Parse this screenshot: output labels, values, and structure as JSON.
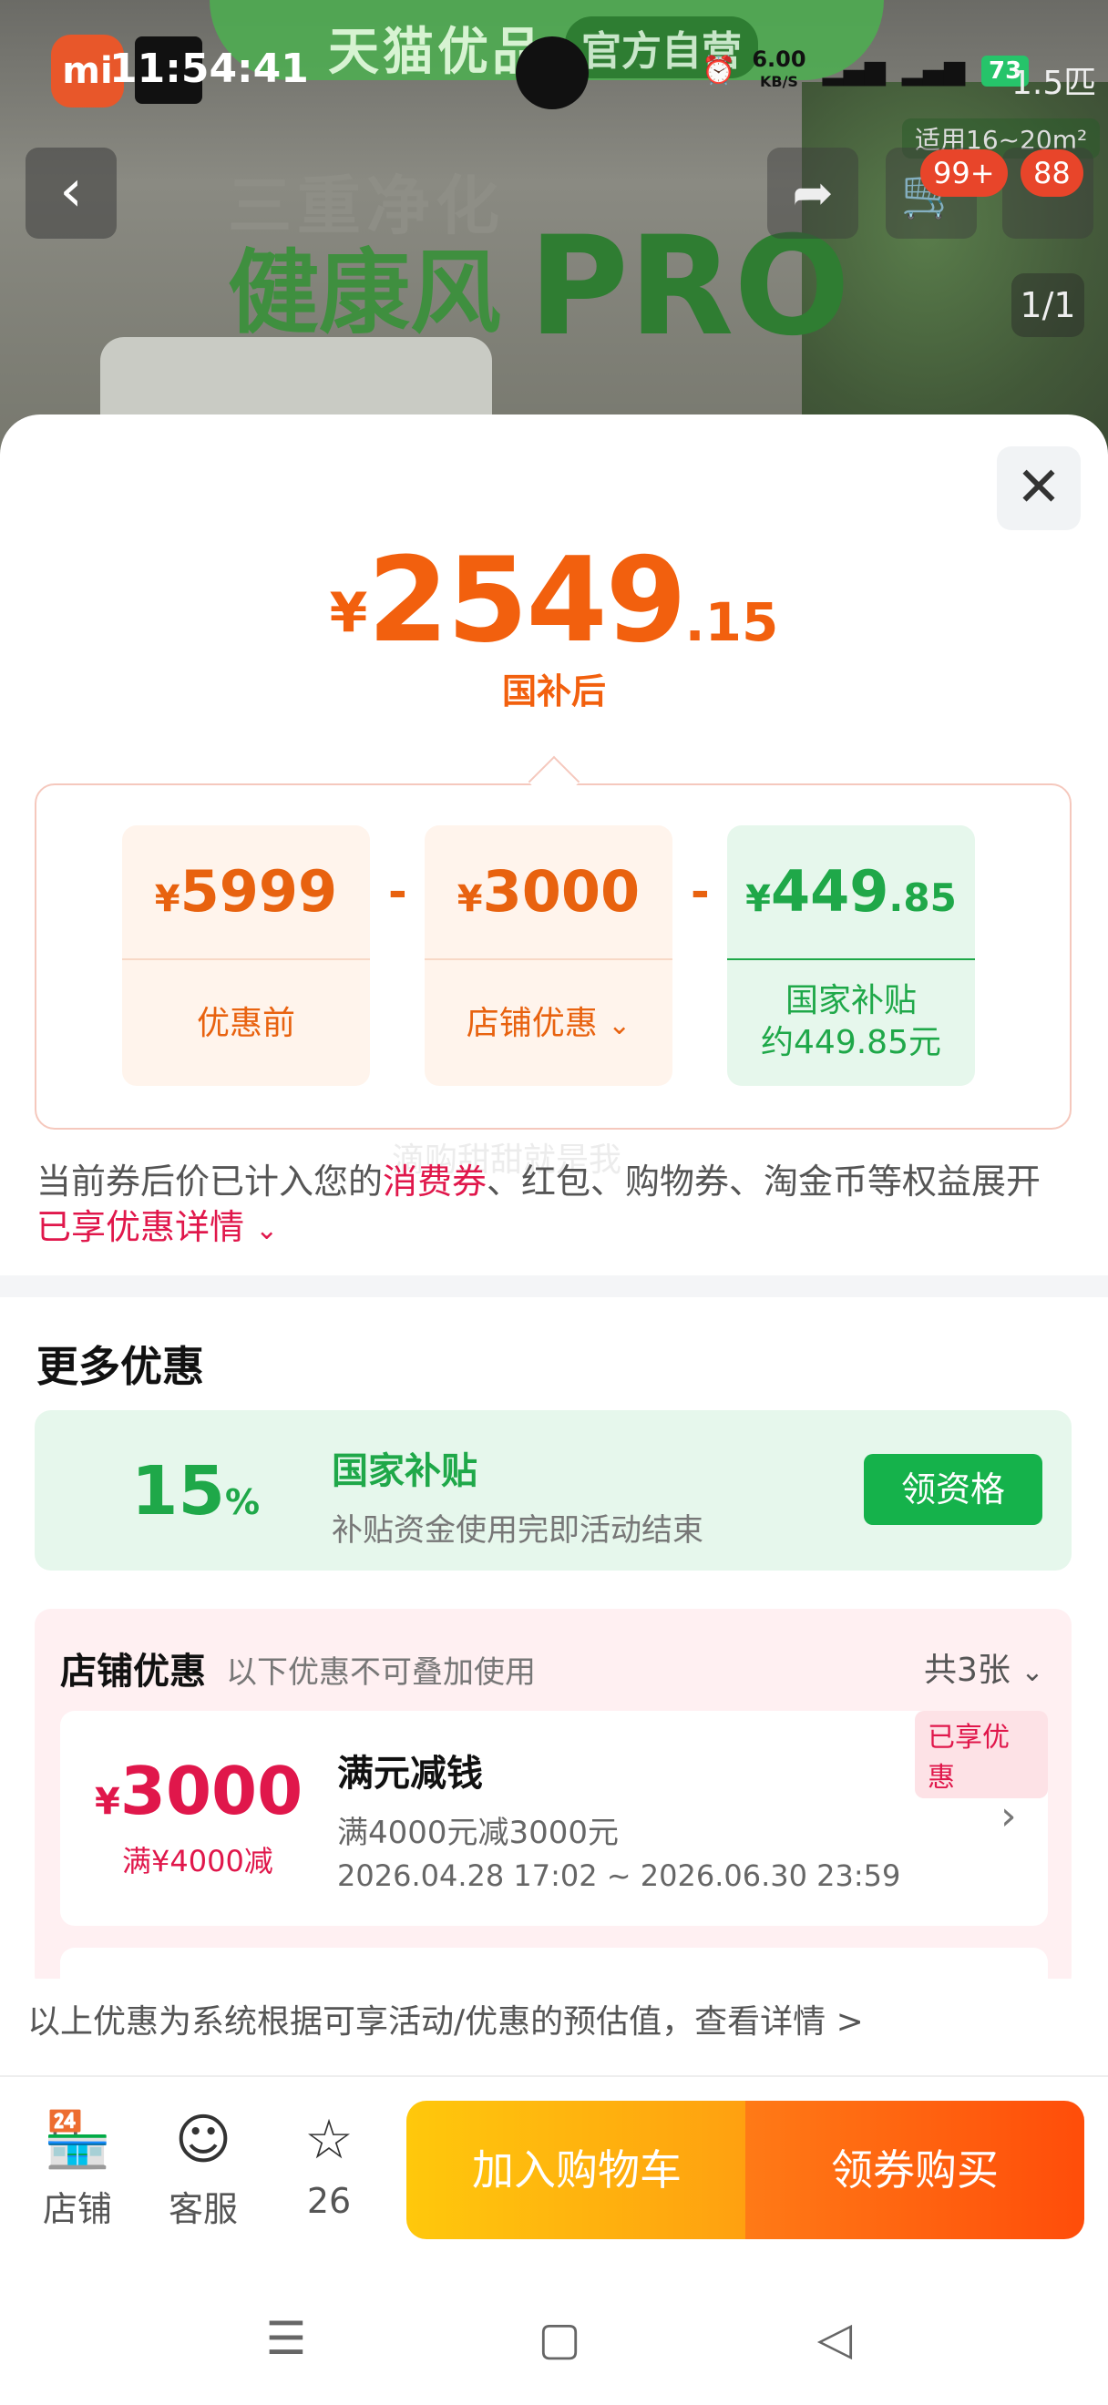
{
  "status_bar": {
    "time": "11:54:41",
    "net_speed": "6.00",
    "net_unit": "KB/S",
    "battery": "73",
    "spec": "1.5匹"
  },
  "hero": {
    "banner_text": "天猫优品",
    "banner_badge": "官方自营",
    "slogan_line1": "三重净化",
    "slogan_line2": "健康风",
    "slogan_pro": "PRO",
    "applicable_area": "适用16~20m²",
    "page_indicator": "1/1",
    "cart_badge": "99+",
    "msg_badge": "88"
  },
  "price": {
    "currency": "¥",
    "integer": "2549",
    "decimal": ".15",
    "label": "国补后"
  },
  "breakdown": {
    "original": {
      "currency": "¥",
      "value": "5999",
      "label": "优惠前"
    },
    "store": {
      "currency": "¥",
      "value": "3000",
      "label": "店铺优惠"
    },
    "subsidy": {
      "currency": "¥",
      "value": "449",
      "decimal": ".85",
      "label_line1": "国家补贴",
      "label_line2": "约449.85元"
    },
    "minus": "-"
  },
  "watermark": "滴购甜甜就是我",
  "note": {
    "part1": "当前券后价已计入您的",
    "highlight": "消费券",
    "part2": "、红包、购物券、淘金币等权益展开",
    "link": "已享优惠详情"
  },
  "more_offers": {
    "title": "更多优惠",
    "subsidy": {
      "percent": "15",
      "percent_sign": "%",
      "title": "国家补贴",
      "desc": "补贴资金使用完即活动结束",
      "button": "领资格"
    },
    "store": {
      "title": "店铺优惠",
      "hint": "以下优惠不可叠加使用",
      "count": "共3张",
      "coupon": {
        "currency": "¥",
        "amount": "3000",
        "condition": "满¥4000减",
        "title": "满元减钱",
        "desc": "满4000元减3000元",
        "date": "2026.04.28 17:02 ~ 2026.06.30 23:59",
        "tag": "已享优惠"
      }
    }
  },
  "estimate_text": "以上优惠为系统根据可享活动/优惠的预估值，查看详情 >",
  "bottom_bar": {
    "shop": "店铺",
    "service": "客服",
    "favorites": "26",
    "add_cart": "加入购物车",
    "buy": "领券购买"
  },
  "colors": {
    "accent_orange": "#f2600e",
    "subsidy_green": "#1fa849",
    "coupon_red": "#e0174b"
  }
}
